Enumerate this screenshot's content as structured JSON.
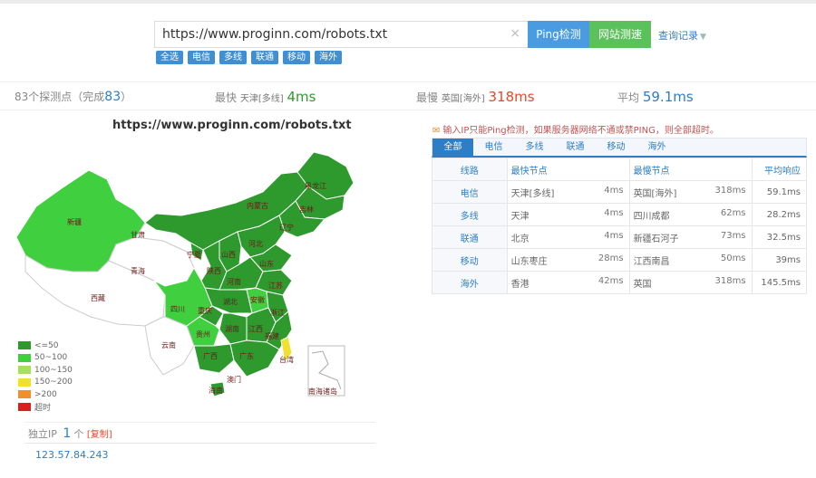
{
  "search": {
    "url": "https://www.proginn.com/robots.txt",
    "clear_icon": "×",
    "ping_button": "Ping检测",
    "speed_button": "网站测速",
    "history_link": "查询记录",
    "filters": [
      "全选",
      "电信",
      "多线",
      "联通",
      "移动",
      "海外"
    ]
  },
  "stats": {
    "probe_prefix": "83个探测点（完成",
    "probe_done": "83",
    "probe_suffix": "）",
    "fastest_label": "最快",
    "fastest_node": "天津[多线]",
    "fastest_value": "4ms",
    "slowest_label": "最慢",
    "slowest_node": "英国[海外]",
    "slowest_value": "318ms",
    "average_label": "平均",
    "average_value": "59.1ms"
  },
  "map": {
    "title": "https://www.proginn.com/robots.txt",
    "province_labels": [
      "新疆",
      "西藏",
      "青海",
      "甘肃",
      "四川",
      "内蒙古",
      "黑龙江",
      "吉林",
      "辽宁",
      "宁夏",
      "山西",
      "河北",
      "陕西",
      "河南",
      "山东",
      "湖北",
      "安徽",
      "江苏",
      "重庆",
      "湖南",
      "江西",
      "浙江",
      "贵州",
      "福建",
      "云南",
      "广西",
      "广东",
      "台湾",
      "澳门",
      "海南",
      "南海诸岛"
    ],
    "legend": [
      {
        "label": "<=50",
        "color": "#2e9a2e"
      },
      {
        "label": "50~100",
        "color": "#3fcf3f"
      },
      {
        "label": "100~150",
        "color": "#a7e060"
      },
      {
        "label": "150~200",
        "color": "#f0e030"
      },
      {
        "label": ">200",
        "color": "#f0902a"
      },
      {
        "label": "超时",
        "color": "#d82020"
      }
    ]
  },
  "standalone_ip": {
    "label": "独立IP",
    "count": "1",
    "unit": "个",
    "copy_link": "[复制]",
    "ip": "123.57.84.243"
  },
  "right_panel": {
    "tip": "输入IP只能Ping检测，如果服务器网络不通或禁PING，则全部超时。",
    "tabs": [
      "全部",
      "电信",
      "多线",
      "联通",
      "移动",
      "海外"
    ],
    "headers": [
      "线路",
      "最快节点",
      "最慢节点",
      "平均响应"
    ],
    "rows": [
      {
        "line": "电信",
        "fast_node": "天津[多线]",
        "fast_ms": "4ms",
        "slow_node": "英国[海外]",
        "slow_ms": "318ms",
        "avg": "59.1ms"
      },
      {
        "line": "多线",
        "fast_node": "天津",
        "fast_ms": "4ms",
        "slow_node": "四川成都",
        "slow_ms": "62ms",
        "avg": "28.2ms"
      },
      {
        "line": "联通",
        "fast_node": "北京",
        "fast_ms": "4ms",
        "slow_node": "新疆石河子",
        "slow_ms": "73ms",
        "avg": "32.5ms"
      },
      {
        "line": "移动",
        "fast_node": "山东枣庄",
        "fast_ms": "28ms",
        "slow_node": "江西南昌",
        "slow_ms": "50ms",
        "avg": "39ms"
      },
      {
        "line": "海外",
        "fast_node": "香港",
        "fast_ms": "42ms",
        "slow_node": "英国",
        "slow_ms": "318ms",
        "avg": "145.5ms"
      }
    ]
  },
  "colors": {
    "accent_blue": "#2d7ec6",
    "ping_blue": "#4a9be0",
    "speed_green": "#5bc25b",
    "red": "#e04a2a"
  }
}
